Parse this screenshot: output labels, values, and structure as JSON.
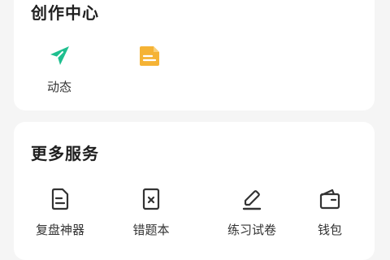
{
  "creation_center": {
    "title": "创作中心",
    "items": [
      {
        "label": "动态",
        "icon": "send-icon",
        "color": "#1fbf8f"
      },
      {
        "label": "",
        "icon": "document-icon",
        "color": "#f5b335"
      }
    ]
  },
  "more_services": {
    "title": "更多服务",
    "items": [
      {
        "label": "复盘神器",
        "icon": "note-icon"
      },
      {
        "label": "错题本",
        "icon": "wrong-book-icon"
      },
      {
        "label": "练习试卷",
        "icon": "pen-icon"
      },
      {
        "label": "钱包",
        "icon": "wallet-icon"
      }
    ]
  },
  "colors": {
    "background": "#f5f5f5",
    "card": "#ffffff",
    "icon_stroke": "#333333"
  }
}
